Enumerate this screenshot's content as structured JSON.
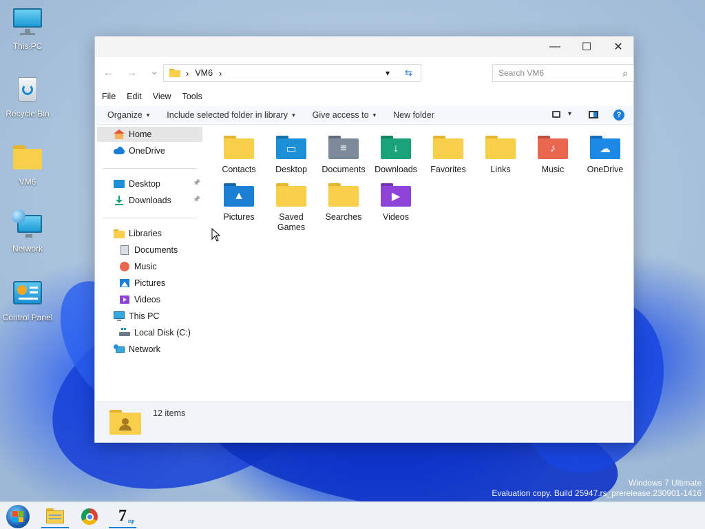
{
  "desktop": {
    "icons": [
      {
        "label": "This PC"
      },
      {
        "label": "Recycle Bin"
      },
      {
        "label": "VM6"
      },
      {
        "label": "Network"
      },
      {
        "label": "Control Panel"
      }
    ]
  },
  "window": {
    "controls": {
      "minimize": "—",
      "maximize": "☐",
      "close": "✕"
    },
    "address": {
      "back": "←",
      "forward": "→",
      "recent": "⌄",
      "breadcrumb_sep": "›",
      "path": "VM6",
      "dropdown": "▾",
      "refresh": "⇆",
      "search_placeholder": "Search VM6",
      "search_glyph": "⌕"
    },
    "menu": [
      "File",
      "Edit",
      "View",
      "Tools"
    ],
    "commands": {
      "organize": "Organize",
      "include_library": "Include selected folder in library",
      "give_access": "Give access to",
      "new_folder": "New folder",
      "caret": "▾",
      "help": "?"
    },
    "nav": {
      "home": "Home",
      "onedrive": "OneDrive",
      "desktop": "Desktop",
      "downloads": "Downloads",
      "pin": "📌",
      "libraries": "Libraries",
      "documents": "Documents",
      "music": "Music",
      "pictures": "Pictures",
      "videos": "Videos",
      "this_pc": "This PC",
      "local_disk": "Local Disk (C:)",
      "network": "Network"
    },
    "items": [
      {
        "label": "Contacts",
        "color": "#f8cf4a"
      },
      {
        "label": "Desktop",
        "color": "#1c8fd6"
      },
      {
        "label": "Documents",
        "color": "#7d8a99"
      },
      {
        "label": "Downloads",
        "color": "#1aa37a"
      },
      {
        "label": "Favorites",
        "color": "#f8cf4a"
      },
      {
        "label": "Links",
        "color": "#f8cf4a"
      },
      {
        "label": "Music",
        "color": "#e8674e"
      },
      {
        "label": "OneDrive",
        "color": "#1e88e5"
      },
      {
        "label": "Pictures",
        "color": "#1b7fd4"
      },
      {
        "label": "Saved Games",
        "color": "#f8cf4a"
      },
      {
        "label": "Searches",
        "color": "#f8cf4a"
      },
      {
        "label": "Videos",
        "color": "#8e44d8"
      }
    ],
    "status": {
      "count": "12 items"
    }
  },
  "watermark": {
    "line1": "Windows 7 Ultimate",
    "line2": "Evaluation copy. Build 25947.rs_prerelease.230901-1416"
  },
  "colors": {
    "folder_yellow": "#f8cf4a",
    "folder_yellow_back": "#e6b52f",
    "accent_blue": "#1a7fd6"
  }
}
